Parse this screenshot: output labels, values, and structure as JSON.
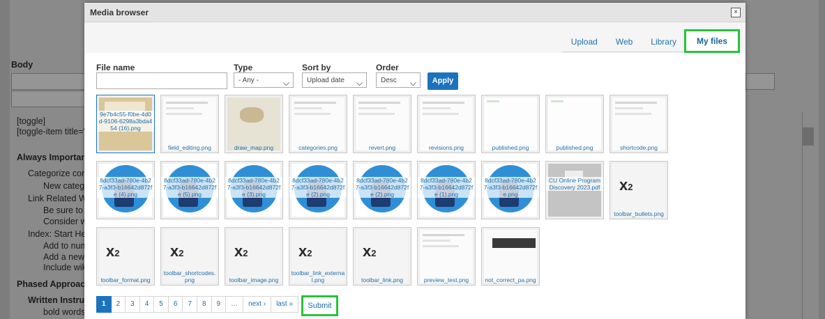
{
  "background": {
    "section_body": "Body",
    "lines": [
      "[toggle]",
      "[toggle-item title=\"",
      "Always Importan",
      "Categorize cor",
      "New categ",
      "Link Related Wi",
      "Be sure to",
      "Consider w",
      "Index: Start He",
      "Add to num",
      "Add a new",
      "Include wik",
      "Phased Approach",
      "Written Instru",
      "bold words"
    ]
  },
  "modal": {
    "title": "Media browser",
    "close_glyph": "×",
    "tabs": [
      {
        "label": "Upload"
      },
      {
        "label": "Web"
      },
      {
        "label": "Library"
      },
      {
        "label": "My files"
      }
    ]
  },
  "filters": {
    "file_name_label": "File name",
    "file_name_value": "",
    "type_label": "Type",
    "type_value": "- Any -",
    "sort_label": "Sort by",
    "sort_value": "Upload date",
    "order_label": "Order",
    "order_value": "Desc",
    "apply_label": "Apply"
  },
  "files": [
    {
      "name": "9e7b4c55-f0be-4d0d-9106-6298a3bda454 (16).png",
      "kind": "building"
    },
    {
      "name": "field_editing.png",
      "kind": "screenshot"
    },
    {
      "name": "draw_map.png",
      "kind": "map"
    },
    {
      "name": "categories.png",
      "kind": "screenshot"
    },
    {
      "name": "revert.png",
      "kind": "screenshot"
    },
    {
      "name": "revisions.png",
      "kind": "screenshot"
    },
    {
      "name": "published.png",
      "kind": "blank"
    },
    {
      "name": "published.png",
      "kind": "blank"
    },
    {
      "name": "shortcode.png",
      "kind": "screenshot"
    },
    {
      "name": "8dcf33ad-780e-4b27-a3f3-b16642d872fe (4).png",
      "kind": "illustration"
    },
    {
      "name": "8dcf33ad-780e-4b27-a3f3-b16642d872fe (5).png",
      "kind": "illustration"
    },
    {
      "name": "8dcf33ad-780e-4b27-a3f3-b16642d872fe (3).png",
      "kind": "illustration"
    },
    {
      "name": "8dcf33ad-780e-4b27-a3f3-b16642d872fe (2).png",
      "kind": "illustration"
    },
    {
      "name": "8dcf33ad-780e-4b27-a3f3-b16642d872fe (2).png",
      "kind": "illustration"
    },
    {
      "name": "8dcf33ad-780e-4b27-a3f3-b16642d872fe (1).png",
      "kind": "illustration"
    },
    {
      "name": "8dcf33ad-780e-4b27-a3f3-b16642d872fe.png",
      "kind": "illustration"
    },
    {
      "name": "CU Online Program Discovery 2023.pdf",
      "kind": "pdf"
    },
    {
      "name": "toolbar_bullets.png",
      "kind": "x2"
    },
    {
      "name": "toolbar_format.png",
      "kind": "x2"
    },
    {
      "name": "toolbar_shortcodes.png",
      "kind": "x2"
    },
    {
      "name": "toolbar_image.png",
      "kind": "x2"
    },
    {
      "name": "toolbar_link_external.png",
      "kind": "x2"
    },
    {
      "name": "toolbar_link.png",
      "kind": "x2"
    },
    {
      "name": "preview_test.png",
      "kind": "screenshot"
    },
    {
      "name": "not_correct_pa.png",
      "kind": "dark"
    }
  ],
  "pager": [
    "1",
    "2",
    "3",
    "4",
    "5",
    "6",
    "7",
    "8",
    "9",
    "…",
    "next ›",
    "last »"
  ],
  "submit_label": "Submit",
  "colors": {
    "accent": "#1b73be",
    "highlight": "#28c23a",
    "link": "#1f6ea8"
  }
}
